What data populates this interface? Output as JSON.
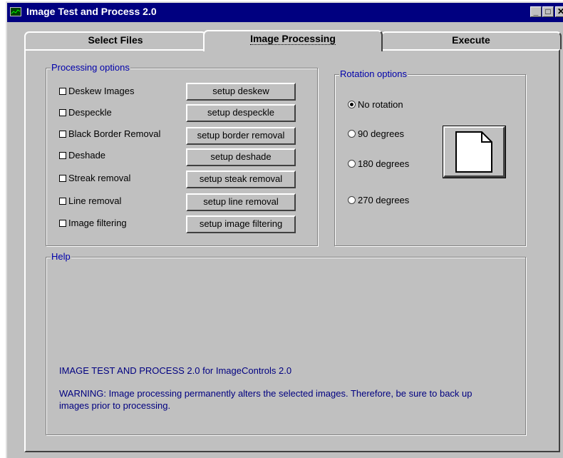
{
  "window": {
    "title": "Image Test and Process 2.0"
  },
  "tabs": [
    {
      "label": "Select Files"
    },
    {
      "label": "Image Processing"
    },
    {
      "label": "Execute"
    }
  ],
  "processing": {
    "legend": "Processing options",
    "options": [
      {
        "label": "Deskew Images",
        "checked": false,
        "button": "setup deskew"
      },
      {
        "label": "Despeckle",
        "checked": false,
        "button": "setup despeckle"
      },
      {
        "label": "Black Border Removal",
        "checked": false,
        "button": "setup border removal"
      },
      {
        "label": "Deshade",
        "checked": false,
        "button": "setup deshade"
      },
      {
        "label": "Streak removal",
        "checked": false,
        "button": "setup steak removal"
      },
      {
        "label": "Line removal",
        "checked": false,
        "button": "setup line removal"
      },
      {
        "label": "Image filtering",
        "checked": false,
        "button": "setup image filtering"
      }
    ]
  },
  "rotation": {
    "legend": "Rotation options",
    "options": [
      {
        "label": "No rotation",
        "selected": true
      },
      {
        "label": "90 degrees",
        "selected": false
      },
      {
        "label": "180 degrees",
        "selected": false
      },
      {
        "label": "270 degrees",
        "selected": false
      }
    ]
  },
  "help": {
    "legend": "Help",
    "line1": "IMAGE TEST AND PROCESS 2.0 for ImageControls 2.0",
    "line2a": "WARNING: Image processing permanently alters the selected images. Therefore, be sure to back up",
    "line2b": "images prior to processing."
  },
  "colors": {
    "titlebar": "#000080",
    "legend": "#0000aa",
    "help_text": "#000080"
  }
}
